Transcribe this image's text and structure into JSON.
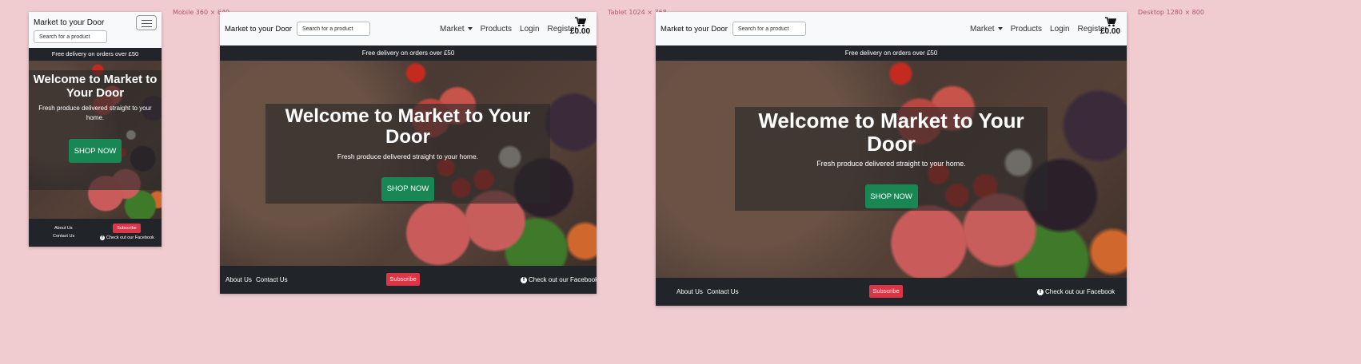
{
  "labels": {
    "mobile": "Mobile 360 × 640",
    "tablet": "Tablet 1024 × 768",
    "desktop": "Desktop 1280 × 800"
  },
  "site": {
    "brand": "Market to your Door",
    "search_placeholder": "Search for a product",
    "nav": {
      "market": "Market",
      "products": "Products",
      "login": "Login",
      "register": "Register",
      "cart_total": "£0.00"
    },
    "banner": "Free delivery on orders over £50",
    "hero": {
      "title": "Welcome to Market to Your Door",
      "subtitle": "Fresh produce delivered straight to your home.",
      "button": "SHOP NOW"
    },
    "footer": {
      "about": "About Us",
      "contact": "Contact Us",
      "subscribe": "Subscribe",
      "facebook": "Check out our Facebook"
    }
  },
  "colors": {
    "background": "#f0ccd0",
    "navbar": "#f8f9fa",
    "dark": "#212529",
    "success": "#198754",
    "danger": "#dc3545"
  }
}
